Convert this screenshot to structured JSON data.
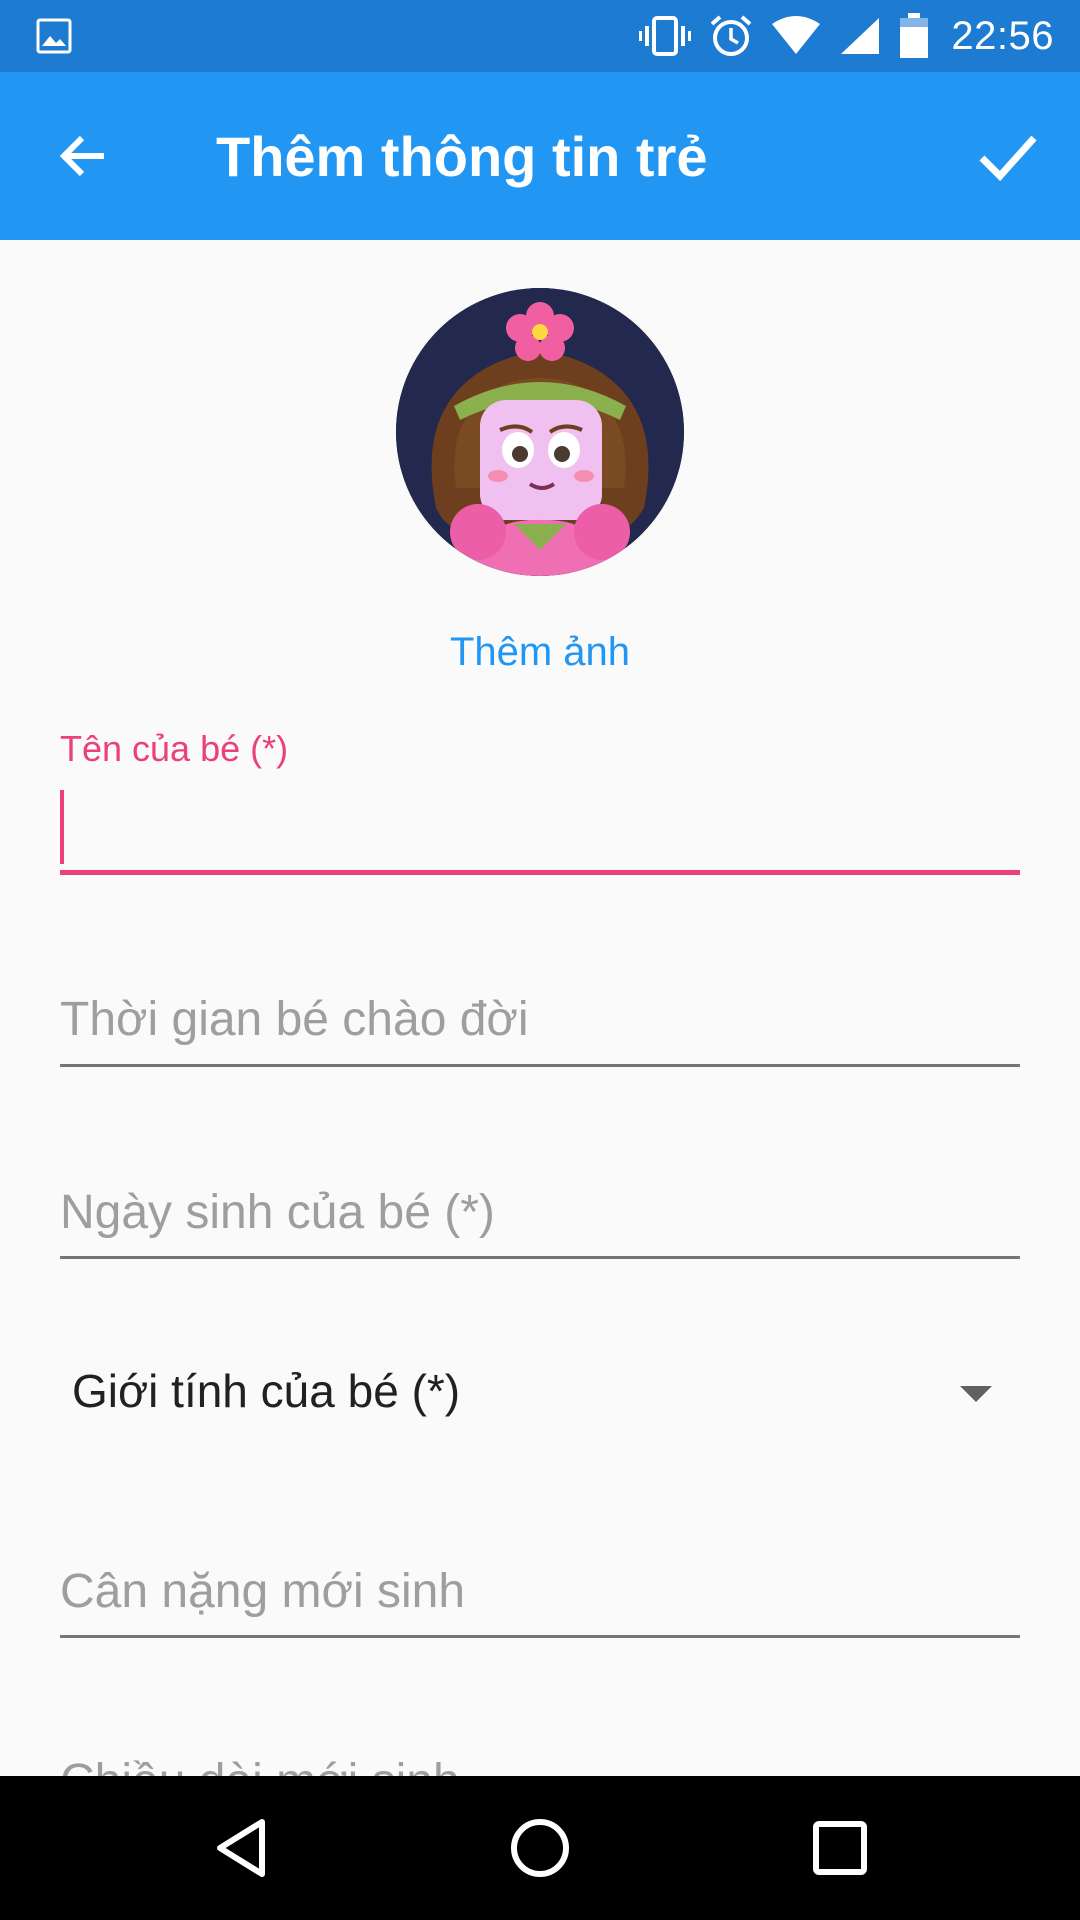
{
  "status_bar": {
    "time": "22:56",
    "icons": [
      "gallery-icon",
      "vibrate-icon",
      "alarm-icon",
      "wifi-icon",
      "signal-icon",
      "battery-icon"
    ]
  },
  "app_bar": {
    "title": "Thêm thông tin trẻ",
    "back_icon": "arrow-back-icon",
    "done_icon": "check-icon"
  },
  "avatar": {
    "add_photo_label": "Thêm ảnh"
  },
  "form": {
    "name_label": "Tên của bé (*)",
    "name_value": "",
    "birth_time_placeholder": "Thời gian bé chào đời",
    "birth_date_placeholder": "Ngày sinh của bé (*)",
    "gender_label": "Giới tính của bé (*)",
    "birth_weight_placeholder": "Cân nặng mới sinh",
    "birth_length_placeholder": "Chiều dài mới sinh"
  },
  "nav_bar": {
    "buttons": [
      "back-triangle-icon",
      "home-circle-icon",
      "recents-square-icon"
    ]
  },
  "colors": {
    "status_bar": "#1e7bd2",
    "app_bar": "#2196f3",
    "accent": "#ec407a",
    "link": "#2196f3"
  }
}
